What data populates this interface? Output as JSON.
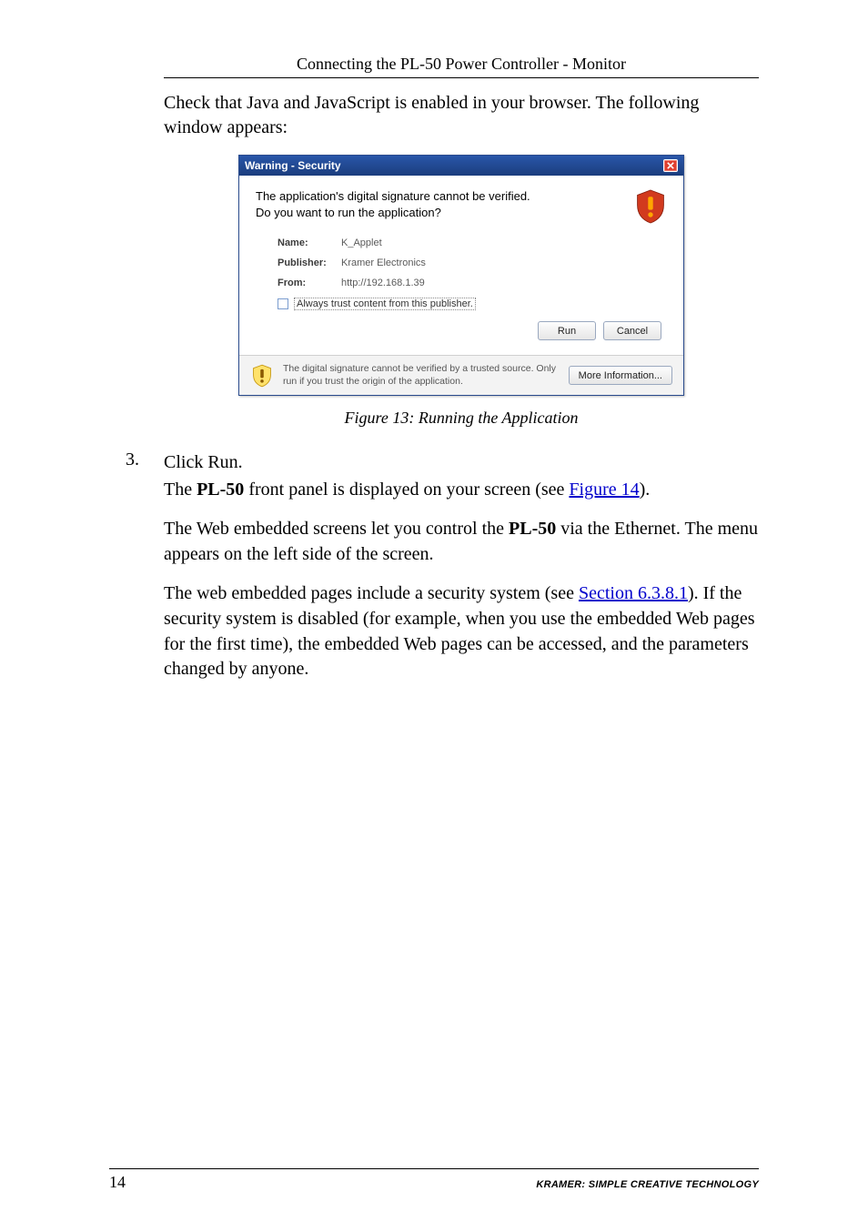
{
  "header": {
    "title": "Connecting the PL-50 Power Controller - Monitor"
  },
  "intro": "Check that Java and JavaScript is enabled in your browser. The following window appears:",
  "dialog": {
    "title": "Warning - Security",
    "message_line1": "The application's digital signature cannot be verified.",
    "message_line2": "Do you want to run the application?",
    "fields": {
      "name_label": "Name:",
      "name_value": "K_Applet",
      "publisher_label": "Publisher:",
      "publisher_value": "Kramer Electronics",
      "from_label": "From:",
      "from_value": "http://192.168.1.39"
    },
    "trust_label": "Always trust content from this publisher.",
    "buttons": {
      "run": "Run",
      "cancel": "Cancel",
      "more": "More Information..."
    },
    "footer_text": "The digital signature cannot be verified by a trusted source. Only run if you trust the origin of the application."
  },
  "figure_caption": "Figure 13: Running the Application",
  "step": {
    "number": "3.",
    "line1": "Click Run.",
    "line2_a": "The ",
    "line2_bold": "PL-50",
    "line2_b": " front panel is displayed on your screen (see ",
    "line2_link": "Figure 14",
    "line2_c": ")."
  },
  "para1": {
    "a": "The Web embedded screens let you control the ",
    "bold": "PL-50",
    "b": " via the Ethernet. The menu appears on the left side of the screen."
  },
  "para2": {
    "a": "The web embedded pages include a security system (see ",
    "link": "Section 6.3.8.1",
    "b": "). If the security system is disabled (for example, when you use the embedded Web pages for the first time), the embedded Web pages can be accessed, and the parameters changed by anyone."
  },
  "footer": {
    "page": "14",
    "brand": "KRAMER:  SIMPLE CREATIVE TECHNOLOGY"
  }
}
